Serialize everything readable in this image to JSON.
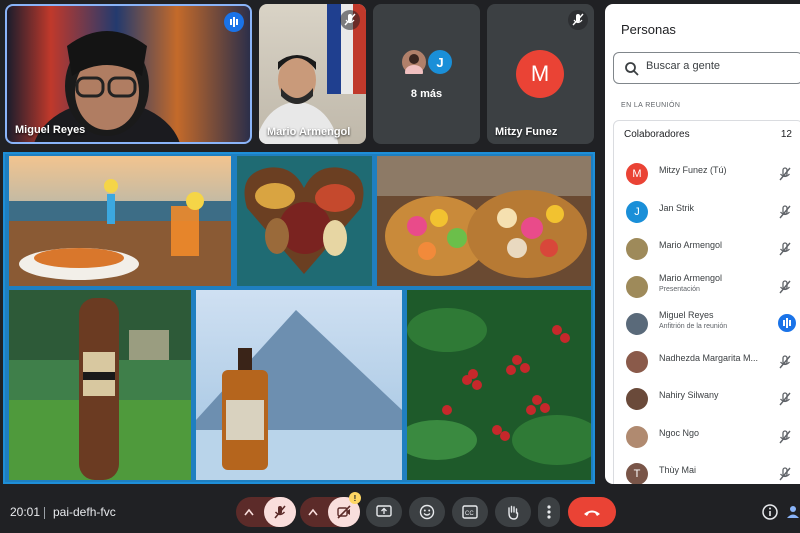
{
  "tiles": {
    "miguel": {
      "name": "Miguel Reyes"
    },
    "mario": {
      "name": "Mario Armengol"
    },
    "more": {
      "label": "8 más",
      "avatar_letter": "J"
    },
    "mitzy": {
      "name": "Mitzy Funez",
      "avatar_letter": "M"
    }
  },
  "panel": {
    "title": "Personas",
    "search_placeholder": "Buscar a gente",
    "section_label": "EN LA REUNIÓN",
    "group_title": "Colaboradores",
    "group_count": "12",
    "people": [
      {
        "name": "Mitzy Funez (Tú)",
        "subtitle": "",
        "letter": "M",
        "color": "#ea4335",
        "status": "mic-off"
      },
      {
        "name": "Jan Strik",
        "subtitle": "",
        "letter": "J",
        "color": "#1a8fd8",
        "status": "mic-off"
      },
      {
        "name": "Mario Armengol",
        "subtitle": "",
        "letter": "",
        "color": "#9e8a5a",
        "status": "mic-off"
      },
      {
        "name": "Mario Armengol",
        "subtitle": "Presentación",
        "letter": "",
        "color": "#9e8a5a",
        "status": "muted-presenting"
      },
      {
        "name": "Miguel Reyes",
        "subtitle": "Anfitrión de la reunión",
        "letter": "",
        "color": "#5a6a7a",
        "status": "speaking"
      },
      {
        "name": "Nadhezda Margarita M...",
        "subtitle": "",
        "letter": "",
        "color": "#8a5a4a",
        "status": "mic-off"
      },
      {
        "name": "Nahiry Silwany",
        "subtitle": "",
        "letter": "",
        "color": "#6a4a3a",
        "status": "mic-off"
      },
      {
        "name": "Ngoc Ngo",
        "subtitle": "",
        "letter": "",
        "color": "#b08a70",
        "status": "mic-off"
      },
      {
        "name": "Thùy Mai",
        "subtitle": "",
        "letter": "T",
        "color": "#795548",
        "status": "mic-off"
      }
    ]
  },
  "bottom": {
    "time": "20:01",
    "meeting_code": "pai-defh-fvc",
    "camera_badge": "!"
  },
  "colors": {
    "background": "#202124",
    "accent_blue": "#1a73e8",
    "end_call": "#ea4335",
    "muted_bg": "#5c2b29",
    "muted_inner": "#f9dedc"
  }
}
